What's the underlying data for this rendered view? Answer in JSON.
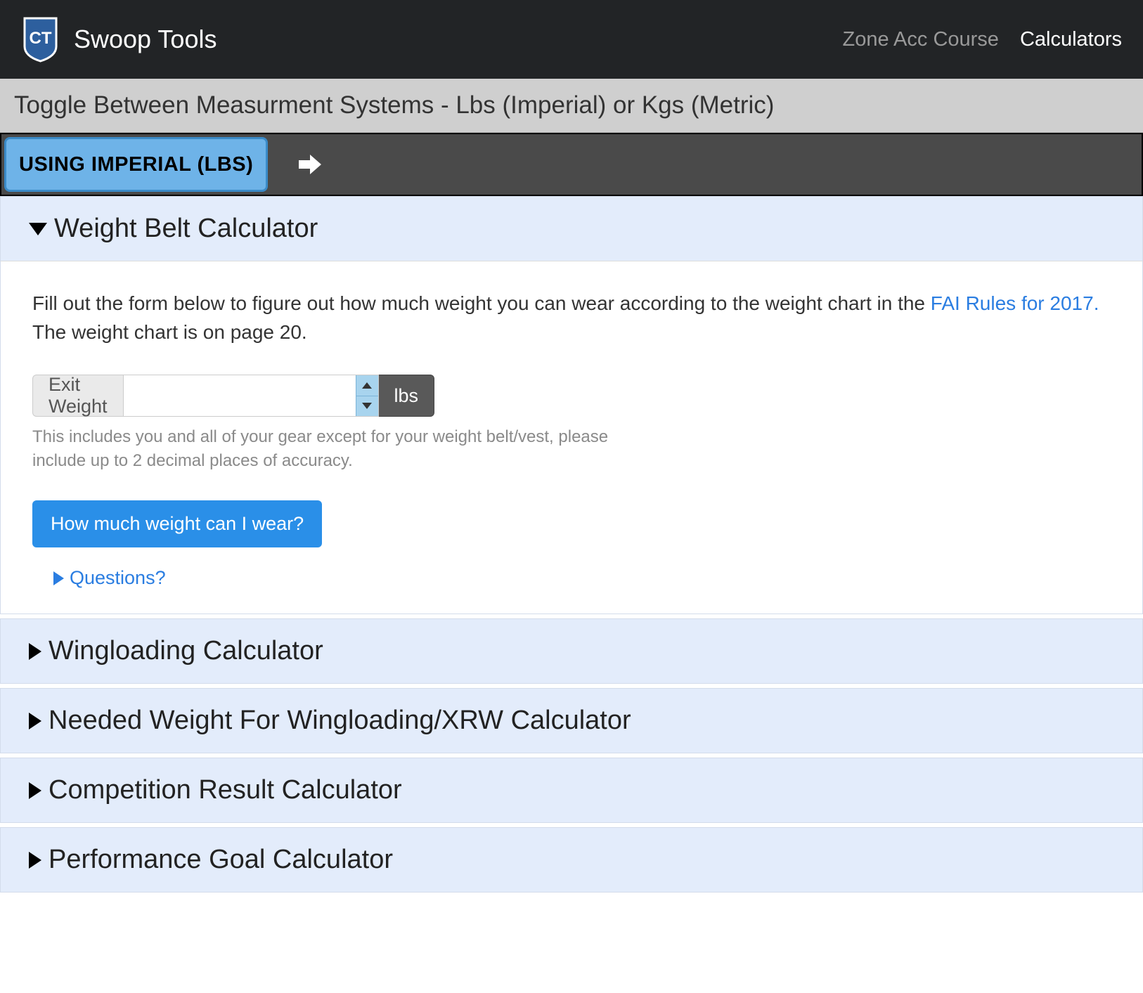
{
  "navbar": {
    "brand": "Swoop Tools",
    "links": [
      {
        "label": "Zone Acc Course",
        "active": false
      },
      {
        "label": "Calculators",
        "active": true
      }
    ]
  },
  "subheader": "Toggle Between Measurment Systems - Lbs (Imperial) or Kgs (Metric)",
  "tabs": {
    "active_label": "USING IMPERIAL (LBS)"
  },
  "accordion": {
    "weight_belt": {
      "title": "Weight Belt Calculator",
      "intro_prefix": "Fill out the form below to figure out how much weight you can wear according to the weight chart in the ",
      "intro_link": "FAI Rules for 2017.",
      "intro_suffix": " The weight chart is on page 20.",
      "input": {
        "label": "Exit Weight",
        "unit": "lbs",
        "value": ""
      },
      "help": "This includes you and all of your gear except for your weight belt/vest, please include up to 2 decimal places of accuracy.",
      "submit": "How much weight can I wear?",
      "questions": "Questions?"
    },
    "collapsed": [
      "Wingloading Calculator",
      "Needed Weight For Wingloading/XRW Calculator",
      "Competition Result Calculator",
      "Performance Goal Calculator"
    ]
  }
}
